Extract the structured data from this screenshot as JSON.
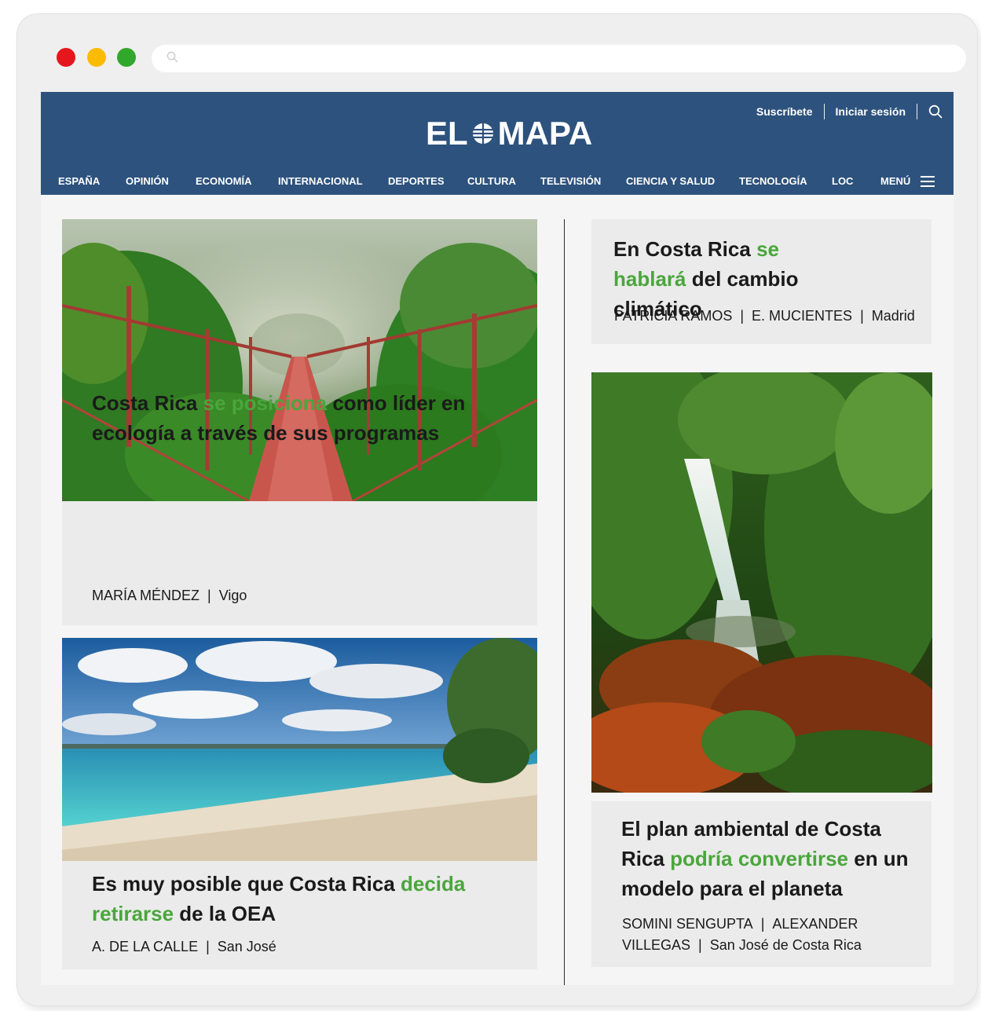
{
  "masthead": {
    "logo_left": "EL",
    "logo_right": "MAPA",
    "subscribe": "Suscríbete",
    "login": "Iniciar sesión",
    "icons": [
      "globe-icon",
      "search-icon",
      "hamburger-menu-icon"
    ]
  },
  "nav": {
    "items": [
      "ESPAÑA",
      "OPINIÓN",
      "ECONOMÍA",
      "INTERNACIONAL",
      "DEPORTES",
      "CULTURA",
      "TELEVISIÓN",
      "CIENCIA Y SALUD",
      "TECNOLOGÍA",
      "LOC"
    ],
    "menu_label": "MENÚ"
  },
  "articles": [
    {
      "title_before": "Costa Rica ",
      "title_highlight": "se posiciona",
      "title_after": " como líder en ecología a través de sus programas",
      "authors": "MARÍA MÉNDEZ",
      "location": "Vigo"
    },
    {
      "title_before": "Es muy posible que Costa Rica ",
      "title_highlight": "decida retirarse",
      "title_after": " de la OEA",
      "authors": "A. DE LA CALLE",
      "location": "San José"
    },
    {
      "title_before": "En Costa Rica ",
      "title_highlight": "se hablará",
      "title_after": " del cambio climático",
      "authors": "PATRICIA RAMOS",
      "authors2": "E. MUCIENTES",
      "location": "Madrid"
    },
    {
      "title_before": "El plan ambiental de Costa Rica ",
      "title_highlight": "podría convertirse",
      "title_after": " en un modelo para el planeta",
      "authors": "SOMINI SENGUPTA",
      "authors2": "ALEXANDER VILLEGAS",
      "location": "San José de Costa Rica"
    }
  ],
  "colors": {
    "masthead": "#2d527d",
    "highlight": "#4aa63c",
    "card": "#ebebeb"
  }
}
